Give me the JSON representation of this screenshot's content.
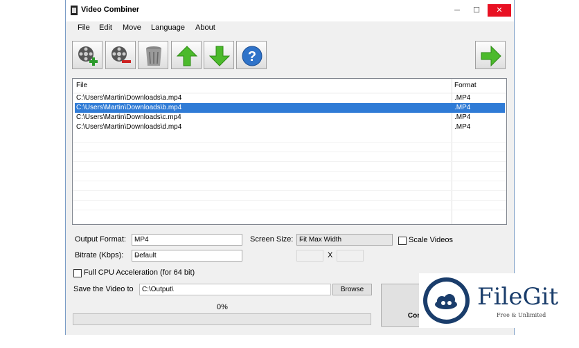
{
  "window": {
    "title": "Video Combiner",
    "controls": {
      "minimize": "─",
      "maximize": "☐",
      "close": "✕"
    }
  },
  "menu": [
    "File",
    "Edit",
    "Move",
    "Language",
    "About"
  ],
  "toolbar": [
    {
      "name": "add-video-button",
      "icon": "film-reel-plus-icon"
    },
    {
      "name": "remove-video-button",
      "icon": "film-reel-minus-icon"
    },
    {
      "name": "clear-list-button",
      "icon": "trash-bin-icon"
    },
    {
      "name": "move-up-button",
      "icon": "arrow-up-icon"
    },
    {
      "name": "move-down-button",
      "icon": "arrow-down-icon"
    },
    {
      "name": "help-button",
      "icon": "question-mark-icon"
    },
    {
      "name": "next-button",
      "icon": "arrow-right-icon"
    }
  ],
  "file_list": {
    "columns": [
      "File",
      "Format"
    ],
    "rows": [
      {
        "file": "C:\\Users\\Martin\\Downloads\\a.mp4",
        "format": ".MP4",
        "selected": false
      },
      {
        "file": "C:\\Users\\Martin\\Downloads\\b.mp4",
        "format": ".MP4",
        "selected": true
      },
      {
        "file": "C:\\Users\\Martin\\Downloads\\c.mp4",
        "format": ".MP4",
        "selected": false
      },
      {
        "file": "C:\\Users\\Martin\\Downloads\\d.mp4",
        "format": ".MP4",
        "selected": false
      }
    ]
  },
  "settings": {
    "output_format_label": "Output Format:",
    "output_format_value": "MP4",
    "screen_size_label": "Screen Size:",
    "screen_size_value": "Fit Max Width",
    "scale_videos_label": "Scale Videos",
    "bitrate_label": "Bitrate (Kbps):",
    "bitrate_value": "Default",
    "size_x": "X",
    "cpu_accel_label": "Full CPU Acceleration (for 64 bit)",
    "save_label": "Save the Video to",
    "save_path": "C:\\Output\\",
    "browse_label": "Browse",
    "progress_text": "0%",
    "progress": 0,
    "combine_label": "Com"
  },
  "watermark": {
    "name": "FileGit",
    "tagline": "Free & Unlimited"
  },
  "colors": {
    "selection": "#2f7bd6",
    "close": "#e81123",
    "brand": "#1a3d6b"
  }
}
